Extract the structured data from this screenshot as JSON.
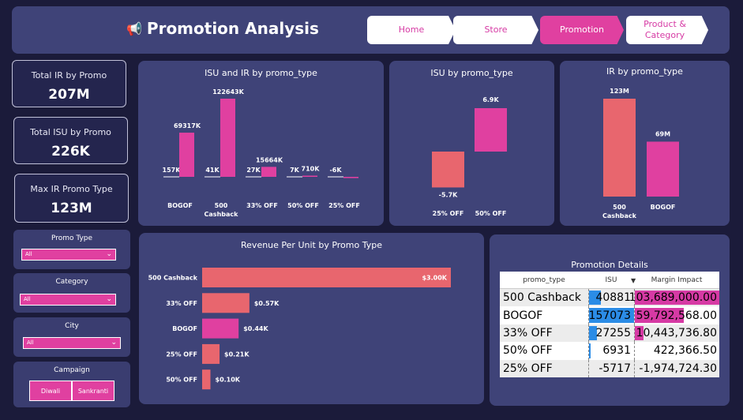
{
  "header": {
    "title": "Promotion Analysis",
    "nav": [
      {
        "label": "Home",
        "active": false
      },
      {
        "label": "Store",
        "active": false
      },
      {
        "label": "Promotion",
        "active": true
      },
      {
        "label": "Product & Category",
        "active": false
      }
    ]
  },
  "kpis": [
    {
      "label": "Total IR by Promo",
      "value": "207M"
    },
    {
      "label": "Total ISU by Promo",
      "value": "226K"
    },
    {
      "label": "Max IR Promo Type",
      "value": "123M"
    }
  ],
  "filters": {
    "promo_type": {
      "label": "Promo Type",
      "value": "All"
    },
    "category": {
      "label": "Category",
      "value": "All"
    },
    "city": {
      "label": "City",
      "value": "All"
    },
    "campaign": {
      "label": "Campaign",
      "options": [
        "Diwali",
        "Sankranti"
      ]
    }
  },
  "colors": {
    "pink": "#e040a0",
    "salmon": "#e8666e",
    "blue": "#2b8ce6",
    "panel": "#3f4378"
  },
  "chart_data": [
    {
      "type": "bar",
      "title": "ISU and IR by promo_type",
      "categories": [
        "BOGOF",
        "500 Cashback",
        "33% OFF",
        "50% OFF",
        "25% OFF"
      ],
      "series": [
        {
          "values": [
            157,
            41,
            27,
            7,
            -6
          ],
          "labels": [
            "157K",
            "41K",
            "27K",
            "7K",
            "-6K"
          ]
        },
        {
          "values": [
            69317,
            122643,
            15664,
            710,
            -1975
          ],
          "labels": [
            "69317K",
            "122643K",
            "15664K",
            "710K",
            ""
          ]
        }
      ]
    },
    {
      "type": "bar",
      "title": "ISU by promo_type",
      "categories": [
        "25% OFF",
        "50% OFF"
      ],
      "values": [
        -5.7,
        6.9
      ],
      "labels": [
        "-5.7K",
        "6.9K"
      ]
    },
    {
      "type": "bar",
      "title": "IR by promo_type",
      "categories": [
        "500 Cashback",
        "BOGOF"
      ],
      "values": [
        123,
        69
      ],
      "labels": [
        "123M",
        "69M"
      ]
    },
    {
      "type": "bar",
      "orientation": "horizontal",
      "title": "Revenue Per Unit by Promo Type",
      "categories": [
        "500 Cashback",
        "33% OFF",
        "BOGOF",
        "25% OFF",
        "50% OFF"
      ],
      "values": [
        3.0,
        0.57,
        0.44,
        0.21,
        0.1
      ],
      "labels": [
        "$3.00K",
        "$0.57K",
        "$0.44K",
        "$0.21K",
        "$0.10K"
      ]
    },
    {
      "type": "table",
      "title": "Promotion Details",
      "columns": [
        "promo_type",
        "ISU",
        "Margin Impact"
      ],
      "rows": [
        {
          "promo_type": "500 Cashback",
          "isu": "40881",
          "margin": "103,689,000.00",
          "isu_num": 40881,
          "margin_num": 103689000
        },
        {
          "promo_type": "BOGOF",
          "isu": "157073",
          "margin": "59,792,568.00",
          "isu_num": 157073,
          "margin_num": 59792568
        },
        {
          "promo_type": "33% OFF",
          "isu": "27255",
          "margin": "10,443,736.80",
          "isu_num": 27255,
          "margin_num": 10443736.8
        },
        {
          "promo_type": "50% OFF",
          "isu": "6931",
          "margin": "422,366.50",
          "isu_num": 6931,
          "margin_num": 422366.5
        },
        {
          "promo_type": "25% OFF",
          "isu": "-5717",
          "margin": "-1,974,724.30",
          "isu_num": -5717,
          "margin_num": -1974724.3
        }
      ]
    }
  ]
}
